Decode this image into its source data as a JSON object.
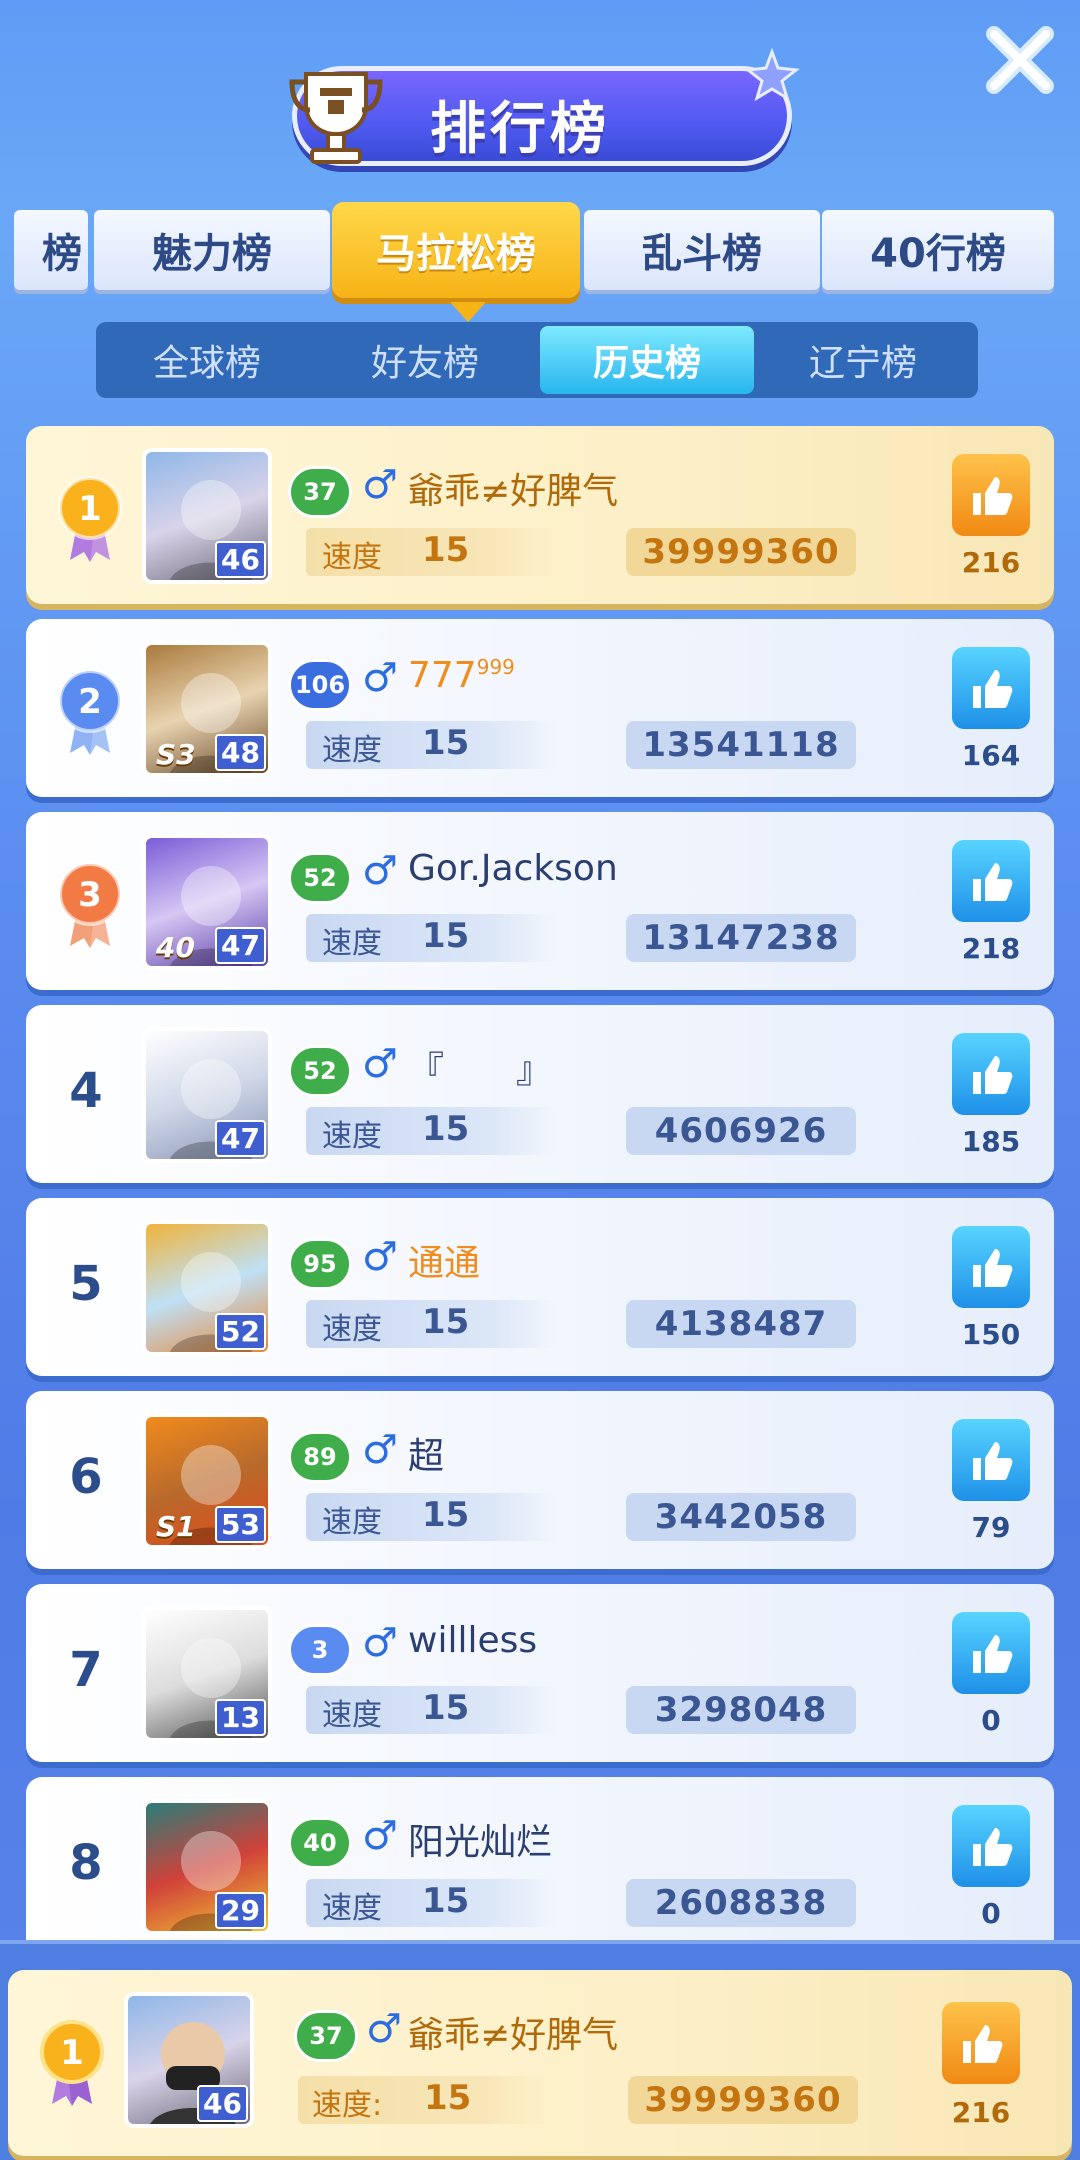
{
  "header": {
    "title": "排行榜",
    "colors": {
      "accent": "#f7b316",
      "primary": "#2f69b8",
      "like": "#1e90e8"
    }
  },
  "main_tabs": [
    {
      "label": "榜"
    },
    {
      "label": "魅力榜"
    },
    {
      "label": "马拉松榜",
      "active": true
    },
    {
      "label": "乱斗榜"
    },
    {
      "label": "40行榜"
    }
  ],
  "sub_tabs": [
    {
      "label": "全球榜"
    },
    {
      "label": "好友榜"
    },
    {
      "label": "历史榜",
      "active": true
    },
    {
      "label": "辽宁榜"
    }
  ],
  "entries": [
    {
      "rank": "1",
      "level": "37",
      "name": "爺乖≠好脾气",
      "speed_label": "速度",
      "speed": "15",
      "score": "39999360",
      "likes": "216",
      "avatar_level": "46",
      "avatar_extra": "",
      "name_sup": ""
    },
    {
      "rank": "2",
      "level": "106",
      "name": "777",
      "name_sup": "999",
      "speed_label": "速度",
      "speed": "15",
      "score": "13541118",
      "likes": "164",
      "avatar_level": "48",
      "avatar_extra": "S3"
    },
    {
      "rank": "3",
      "level": "52",
      "name": "Gor.Jackson",
      "speed_label": "速度",
      "speed": "15",
      "score": "13147238",
      "likes": "218",
      "avatar_level": "47",
      "avatar_extra": "40",
      "name_sup": ""
    },
    {
      "rank": "4",
      "level": "52",
      "name": "『　　』",
      "speed_label": "速度",
      "speed": "15",
      "score": "4606926",
      "likes": "185",
      "avatar_level": "47",
      "avatar_extra": "",
      "name_sup": ""
    },
    {
      "rank": "5",
      "level": "95",
      "name": "通通",
      "speed_label": "速度",
      "speed": "15",
      "score": "4138487",
      "likes": "150",
      "avatar_level": "52",
      "avatar_extra": "",
      "name_sup": ""
    },
    {
      "rank": "6",
      "level": "89",
      "name": "超",
      "speed_label": "速度",
      "speed": "15",
      "score": "3442058",
      "likes": "79",
      "avatar_level": "53",
      "avatar_extra": "S1",
      "name_sup": ""
    },
    {
      "rank": "7",
      "level": "3",
      "name": "willless",
      "speed_label": "速度",
      "speed": "15",
      "score": "3298048",
      "likes": "0",
      "avatar_level": "13",
      "avatar_extra": "",
      "name_sup": ""
    },
    {
      "rank": "8",
      "level": "40",
      "name": "阳光灿烂",
      "speed_label": "速度",
      "speed": "15",
      "score": "2608838",
      "likes": "0",
      "avatar_level": "29",
      "avatar_extra": "",
      "name_sup": ""
    }
  ],
  "my_entry": {
    "rank": "1",
    "level": "37",
    "name": "爺乖≠好脾气",
    "speed_label": "速度:",
    "speed": "15",
    "score": "39999360",
    "likes": "216",
    "avatar_level": "46"
  }
}
